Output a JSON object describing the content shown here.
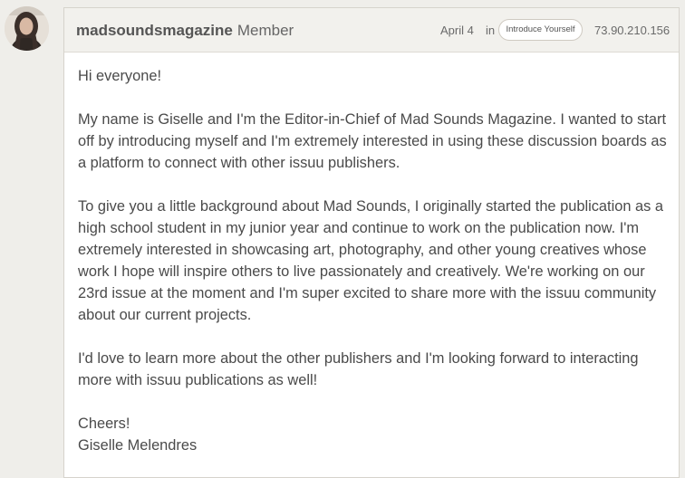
{
  "author": {
    "username": "madsoundsmagazine",
    "role": "Member"
  },
  "meta": {
    "date": "April 4",
    "in_label": "in",
    "category": "Introduce Yourself",
    "ip": "73.90.210.156"
  },
  "body": {
    "greeting": "Hi everyone!",
    "paragraph1": "My name is Giselle and I'm the Editor-in-Chief of Mad Sounds Magazine. I wanted to start off by introducing myself and I'm extremely interested in using these discussion boards as a platform to connect with other issuu publishers.",
    "paragraph2": "To give you a little background about Mad Sounds, I originally started the publication as a high school student in my junior year and continue to work on the publication now. I'm extremely interested in showcasing art, photography, and other young creatives whose work I hope will inspire others to live passionately and creatively. We're working on our 23rd issue at the moment and I'm super excited to share more with the issuu community about our current projects.",
    "paragraph3": "I'd love to learn more about the other publishers and I'm looking forward to interacting more with issuu publications as well!",
    "closing": "Cheers!",
    "signature": "Giselle Melendres"
  }
}
